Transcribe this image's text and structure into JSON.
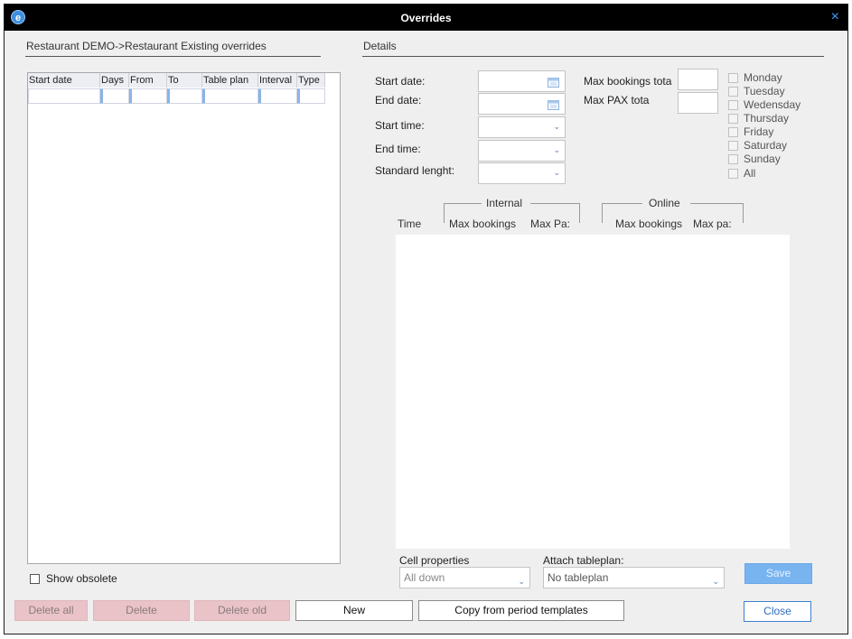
{
  "window": {
    "title": "Overrides",
    "close_glyph": "×",
    "icon_letter": "e"
  },
  "left_panel": {
    "title": "Restaurant DEMO->Restaurant Existing overrides",
    "columns": [
      "Start date",
      "Days",
      "From",
      "To",
      "Table plan",
      "Interval",
      "Type"
    ],
    "show_obsolete_label": "Show obsolete",
    "show_obsolete_checked": false
  },
  "details": {
    "title": "Details",
    "start_date_label": "Start date:",
    "end_date_label": "End date:",
    "start_time_label": "Start time:",
    "end_time_label": "End time:",
    "standard_length_label": "Standard lenght:",
    "max_bookings_total_label": "Max bookings tota",
    "max_pax_total_label": "Max PAX tota",
    "days": [
      "Monday",
      "Tuesday",
      "Wedensday",
      "Thursday",
      "Friday",
      "Saturday",
      "Sunday",
      "All"
    ]
  },
  "schedule": {
    "internal_header": "Internal",
    "online_header": "Online",
    "col_time": "Time",
    "col_internal_max_bookings": "Max bookings",
    "col_internal_max_pax": "Max Pa:",
    "col_online_max_bookings": "Max bookings",
    "col_online_max_pax": "Max pa:"
  },
  "cell_properties": {
    "label": "Cell properties",
    "value": "All down"
  },
  "attach_tableplan": {
    "label": "Attach tableplan:",
    "value": "No tableplan"
  },
  "buttons": {
    "delete_all": "Delete all",
    "delete": "Delete",
    "delete_old": "Delete old",
    "new": "New",
    "copy_templates": "Copy from period templates",
    "save": "Save",
    "close": "Close"
  },
  "colors": {
    "titlebar": "#000000",
    "disabled_button": "#e9c3c7",
    "save_button": "#78b4f0",
    "close_border": "#3f7fd0"
  }
}
